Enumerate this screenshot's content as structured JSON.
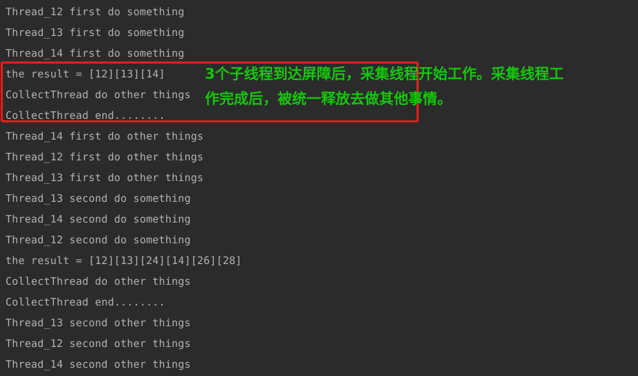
{
  "console": {
    "background_color": "#2b2b2b",
    "text_color": "#b3b3b3",
    "lines": [
      {
        "text": "Thread_12 first do something"
      },
      {
        "text": "Thread_13 first do something"
      },
      {
        "text": "Thread_14 first do something"
      },
      {
        "text": "the result = [12][13][14]"
      },
      {
        "text": "CollectThread do other things"
      },
      {
        "text": "CollectThread end........"
      },
      {
        "text": "Thread_14 first do other things"
      },
      {
        "text": "Thread_12 first do other things"
      },
      {
        "text": "Thread_13 first do other things"
      },
      {
        "text": "Thread_13 second do something"
      },
      {
        "text": "Thread_14 second do something"
      },
      {
        "text": "Thread_12 second do something"
      },
      {
        "text": "the result = [12][13][24][14][26][28]"
      },
      {
        "text": "CollectThread do other things"
      },
      {
        "text": "CollectThread end........"
      },
      {
        "text": "Thread_13 second other things"
      },
      {
        "text": "Thread_12 second other things"
      },
      {
        "text": "Thread_14 second other things"
      }
    ]
  },
  "annotation": {
    "box_color": "#ee1c1c",
    "text_color": "#16c60c",
    "line_1": "3个子线程到达屏障后，采集线程开始工作。采集线程工",
    "line_2": "作完成后，被统一释放去做其他事情。"
  }
}
